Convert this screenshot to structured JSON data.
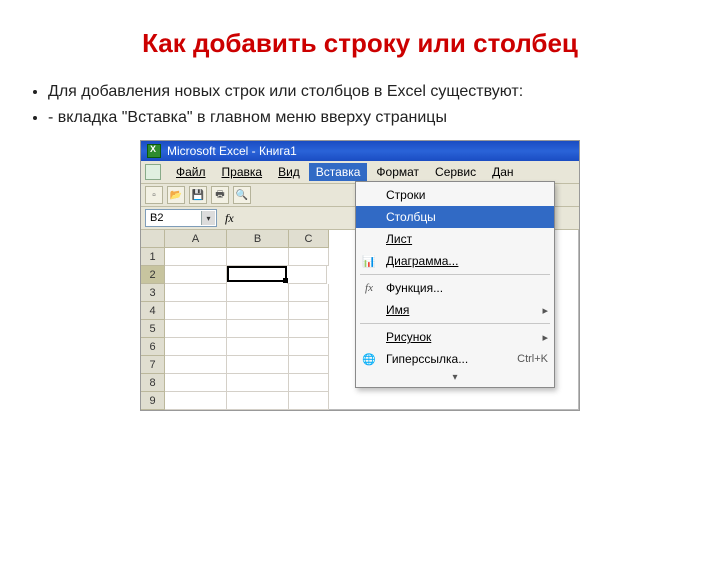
{
  "slide": {
    "title": "Как добавить строку или столбец",
    "bullet1": "Для добавления новых строк или столбцов в Excel существуют:",
    "bullet2": "- вкладка \"Вставка\" в главном меню вверху страницы"
  },
  "titlebar": {
    "app": "Microsoft Excel - Книга1"
  },
  "menubar": {
    "file": "Файл",
    "edit": "Правка",
    "view": "Вид",
    "insert": "Вставка",
    "format": "Формат",
    "service": "Сервис",
    "data": "Дан"
  },
  "namebox": {
    "value": "B2"
  },
  "fxlabel": "fx",
  "columns": [
    "A",
    "B",
    "C"
  ],
  "rownums": [
    "1",
    "2",
    "3",
    "4",
    "5",
    "6",
    "7",
    "8",
    "9"
  ],
  "dropdown": {
    "rows": "Строки",
    "cols": "Столбцы",
    "sheet": "Лист",
    "chart": "Диаграмма...",
    "func": "Функция...",
    "name": "Имя",
    "picture": "Рисунок",
    "hyperlink": "Гиперссылка...",
    "hyperlink_key": "Ctrl+K"
  }
}
